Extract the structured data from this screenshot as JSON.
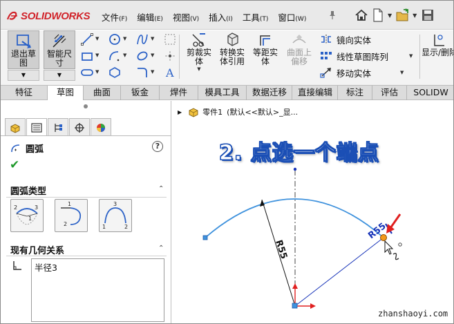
{
  "app": {
    "brand": "SOLIDWORKS",
    "menus": [
      {
        "label": "文件",
        "key": "(F)"
      },
      {
        "label": "编辑",
        "key": "(E)"
      },
      {
        "label": "视图",
        "key": "(V)"
      },
      {
        "label": "插入",
        "key": "(I)"
      },
      {
        "label": "工具",
        "key": "(T)"
      },
      {
        "label": "窗口",
        "key": "(W)"
      }
    ]
  },
  "ribbon": {
    "exit_sketch": "退出草图",
    "smart_dimension": "智能尺寸",
    "trim_entities": "剪裁实体",
    "convert_entities": "转换实体引用",
    "offset_entities": "等距实体",
    "offset_on_surface": "曲面上偏移",
    "mirror_entities": "镜向实体",
    "linear_pattern": "线性草图阵列",
    "move_entities": "移动实体",
    "display_delete_relations": "显示/删除几何关"
  },
  "tabs": [
    "特征",
    "草图",
    "曲面",
    "钣金",
    "焊件",
    "模具工具",
    "数据迁移",
    "直接编辑",
    "标注",
    "评估",
    "SOLIDW"
  ],
  "active_tab": "草图",
  "property_manager": {
    "title": "圆弧",
    "arc_type_header": "圆弧类型",
    "existing_relations_header": "现有几何关系",
    "relations": [
      "半径3"
    ]
  },
  "canvas": {
    "tree_part": "零件1",
    "tree_config": "(默认<<默认>_显...",
    "instruction": "2. 点选一个端点",
    "dimension_left": "R55",
    "dimension_right": "R55"
  },
  "colors": {
    "brand_red": "#d1232a",
    "sketch_blue": "#3f92dd",
    "dimension_blue": "#1733b8",
    "endpoint_orange": "#f39a1b",
    "arrow_red": "#e02020"
  },
  "watermark": "zhanshaoyi.com"
}
